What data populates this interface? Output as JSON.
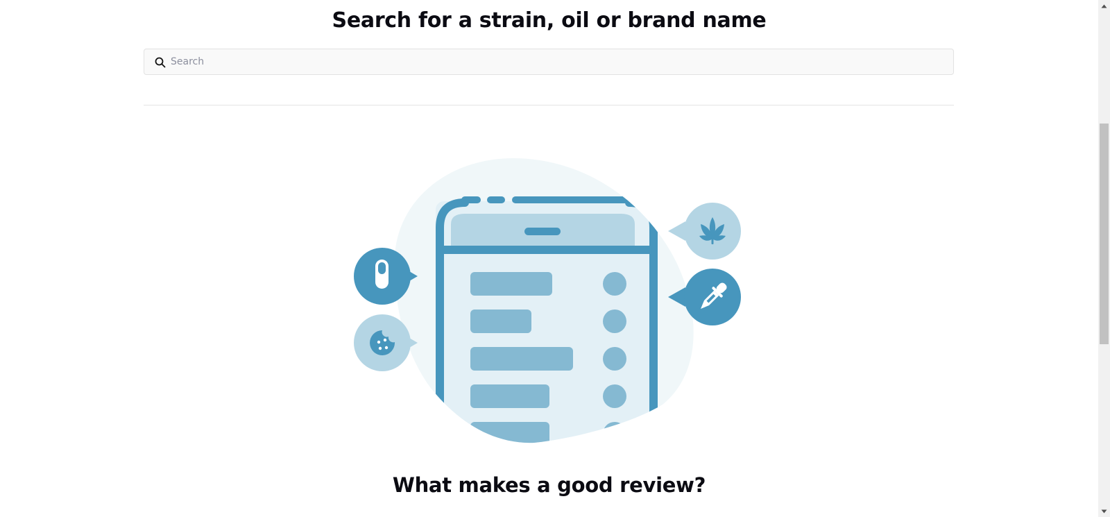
{
  "heading": {
    "title": "Search for a strain, oil or brand name"
  },
  "search": {
    "placeholder": "Search",
    "value": "",
    "icon": "search-icon"
  },
  "illustration": {
    "icons": [
      "phone-list-illustration",
      "capsule-icon",
      "cookie-icon",
      "cannabis-leaf-icon",
      "dropper-icon"
    ],
    "colors": {
      "blob": "#f0f7f9",
      "primary": "#4796bd",
      "light": "#b4d5e4",
      "screen": "#e3f0f6",
      "bar": "#85b9d2"
    }
  },
  "section": {
    "subtitle": "What makes a good review?"
  },
  "scrollbar": {
    "scroll_fraction": 0.25
  }
}
